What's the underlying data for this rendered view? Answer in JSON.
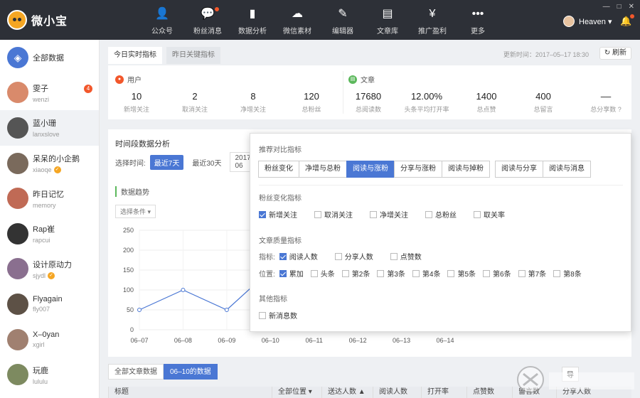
{
  "app": {
    "name": "微小宝"
  },
  "nav": [
    {
      "label": "公众号",
      "icon": "person-icon",
      "glyph": "👤",
      "dot": false
    },
    {
      "label": "粉丝消息",
      "icon": "chat-bubble-icon",
      "glyph": "💬",
      "dot": true
    },
    {
      "label": "数据分析",
      "icon": "bar-chart-icon",
      "glyph": "▮",
      "dot": false
    },
    {
      "label": "微信素材",
      "icon": "wechat-icon",
      "glyph": "☁",
      "dot": false
    },
    {
      "label": "编辑器",
      "icon": "pen-icon",
      "glyph": "✎",
      "dot": false
    },
    {
      "label": "文章库",
      "icon": "book-icon",
      "glyph": "▤",
      "dot": false
    },
    {
      "label": "推广盈利",
      "icon": "money-bag-icon",
      "glyph": "¥",
      "dot": false
    },
    {
      "label": "更多",
      "icon": "more-dots-icon",
      "glyph": "•••",
      "dot": false
    }
  ],
  "user": {
    "name": "Heaven ▾"
  },
  "sidebar": {
    "all": "全部数据",
    "contacts": [
      {
        "name": "雯子",
        "id": "wenzi",
        "color": "#d98a6b",
        "verified": false
      },
      {
        "name": "蓝小珊",
        "id": "lanxslove",
        "color": "#555",
        "verified": false
      },
      {
        "name": "呆呆的小企鹅",
        "id": "xiaoqe",
        "color": "#7a6a5c",
        "verified": true
      },
      {
        "name": "昨日记忆",
        "id": "memory",
        "color": "#c06a55",
        "verified": false
      },
      {
        "name": "Rap崔",
        "id": "rapcui",
        "color": "#333",
        "verified": false
      },
      {
        "name": "设计原动力",
        "id": "sjydl",
        "color": "#8a6f8f",
        "verified": true
      },
      {
        "name": "Flyagain",
        "id": "fly007",
        "color": "#5d5146",
        "verified": false
      },
      {
        "name": "X–0yan",
        "id": "xgirl",
        "color": "#a08070",
        "verified": false
      },
      {
        "name": "玩鹿",
        "id": "lululu",
        "color": "#7d8a60",
        "verified": false
      }
    ],
    "badge": "4"
  },
  "tabs": [
    "今日实时指标",
    "昨日关键指标"
  ],
  "updated": "更新时间：2017–05–17 18:30",
  "refresh": "刷新",
  "users_section": {
    "title": "用户",
    "stats": [
      {
        "v": "10",
        "l": "新增关注"
      },
      {
        "v": "2",
        "l": "取消关注"
      },
      {
        "v": "8",
        "l": "净增关注"
      },
      {
        "v": "120",
        "l": "总粉丝"
      }
    ]
  },
  "article_section": {
    "title": "文章",
    "stats": [
      {
        "v": "17680",
        "l": "总阅读数"
      },
      {
        "v": "12.00%",
        "l": "头条平均打开率"
      },
      {
        "v": "1400",
        "l": "总点赞"
      },
      {
        "v": "400",
        "l": "总留言"
      },
      {
        "v": "––",
        "l": "总分享数 ?"
      }
    ]
  },
  "period": {
    "title": "时间段数据分析",
    "label": "选择时间:",
    "b7": "最近7天",
    "b30": "最近30天",
    "date": "2017–06",
    "trend": "数据趋势",
    "condition": "选择条件 ▾"
  },
  "chart_data": {
    "type": "line",
    "x": [
      "06–07",
      "06–08",
      "06–09",
      "06–10",
      "06–11",
      "06–12",
      "06–13",
      "06–14"
    ],
    "y_ticks": [
      0,
      50,
      100,
      150,
      200,
      250
    ],
    "ylim": [
      0,
      250
    ],
    "series": [
      {
        "values": [
          50,
          100,
          50,
          150
        ]
      }
    ],
    "color": "#4a77d4"
  },
  "popup": {
    "recommend": "推荐对比指标",
    "seg1": [
      "粉丝变化",
      "净增与总粉",
      "阅读与涨粉",
      "分享与涨粉",
      "阅读与掉粉"
    ],
    "seg2": [
      "阅读与分享",
      "阅读与消息"
    ],
    "fans_title": "粉丝变化指标",
    "fans": [
      {
        "label": "新增关注",
        "on": true
      },
      {
        "label": "取消关注",
        "on": false
      },
      {
        "label": "净增关注",
        "on": false
      },
      {
        "label": "总粉丝",
        "on": false
      },
      {
        "label": "取关率",
        "on": false
      }
    ],
    "quality_title": "文章质量指标",
    "metric_label": "指标:",
    "metrics": [
      {
        "label": "阅读人数",
        "on": true
      },
      {
        "label": "分享人数",
        "on": false
      },
      {
        "label": "点赞数",
        "on": false
      }
    ],
    "pos_label": "位置:",
    "positions": [
      {
        "label": "累加",
        "on": true
      },
      {
        "label": "头条",
        "on": false
      },
      {
        "label": "第2条",
        "on": false
      },
      {
        "label": "第3条",
        "on": false
      },
      {
        "label": "第4条",
        "on": false
      },
      {
        "label": "第5条",
        "on": false
      },
      {
        "label": "第6条",
        "on": false
      },
      {
        "label": "第7条",
        "on": false
      },
      {
        "label": "第8条",
        "on": false
      }
    ],
    "other_title": "其他指标",
    "other": [
      {
        "label": "新消息数",
        "on": false
      }
    ]
  },
  "bottom": {
    "tabs": [
      "全部文章数据",
      "06–10的数据"
    ],
    "export": "导",
    "headers": [
      "标题",
      "全部位置 ▾",
      "送达人数 ▲",
      "阅读人数",
      "打开率",
      "点赞数",
      "留言数",
      "分享人数"
    ]
  }
}
